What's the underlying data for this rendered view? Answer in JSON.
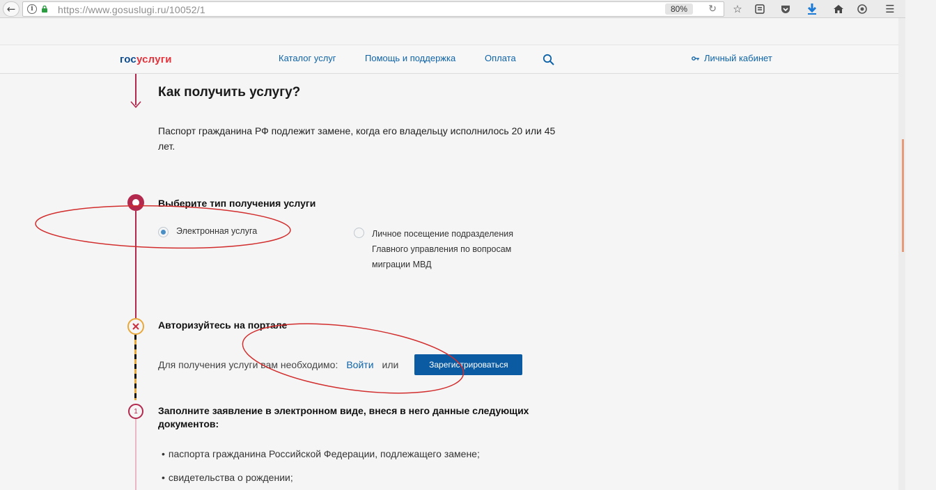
{
  "browser": {
    "url": "https://www.gosuslugi.ru/10052/1",
    "zoom": "80%",
    "icons": [
      "back-icon",
      "info-icon",
      "lock-icon",
      "reload-icon",
      "bookmark-star-icon",
      "reader-icon",
      "pocket-icon",
      "download-icon",
      "home-icon",
      "sync-icon",
      "menu-icon"
    ]
  },
  "header": {
    "logo_part1": "гос",
    "logo_part2": "услуги",
    "nav": [
      "Каталог услуг",
      "Помощь и поддержка",
      "Оплата"
    ],
    "cabinet": "Личный кабинет",
    "colors": {
      "link": "#0e63a8",
      "logo_blue": "#0d4c8f",
      "logo_red": "#e5323b"
    }
  },
  "content": {
    "title": "Как получить услугу?",
    "lead": "Паспорт гражданина РФ подлежит замене, когда его владельцу исполнилось 20 или 45 лет.",
    "step_type": {
      "title": "Выберите тип получения услуги",
      "option_electronic": "Электронная услуга",
      "option_visit_line1": "Личное посещение подразделения",
      "option_visit_line2": "Главного управления по вопросам",
      "option_visit_line3": "миграции МВД",
      "selected": "option_electronic"
    },
    "step_auth": {
      "title": "Авторизуйтесь на портале",
      "text": "Для получения услуги вам необходимо:",
      "login": "Войти",
      "or": "или",
      "register": "Зарегистрироваться"
    },
    "step_form": {
      "number": "1",
      "title_line1": "Заполните заявление в электронном виде, внеся в него данные следующих",
      "title_line2": "документов:",
      "items": [
        "паспорта гражданина Российской Федерации, подлежащего замене;",
        "свидетельства о рождении;"
      ]
    },
    "timeline_color": "#b3294e",
    "annotation_color": "#d22d2d"
  }
}
